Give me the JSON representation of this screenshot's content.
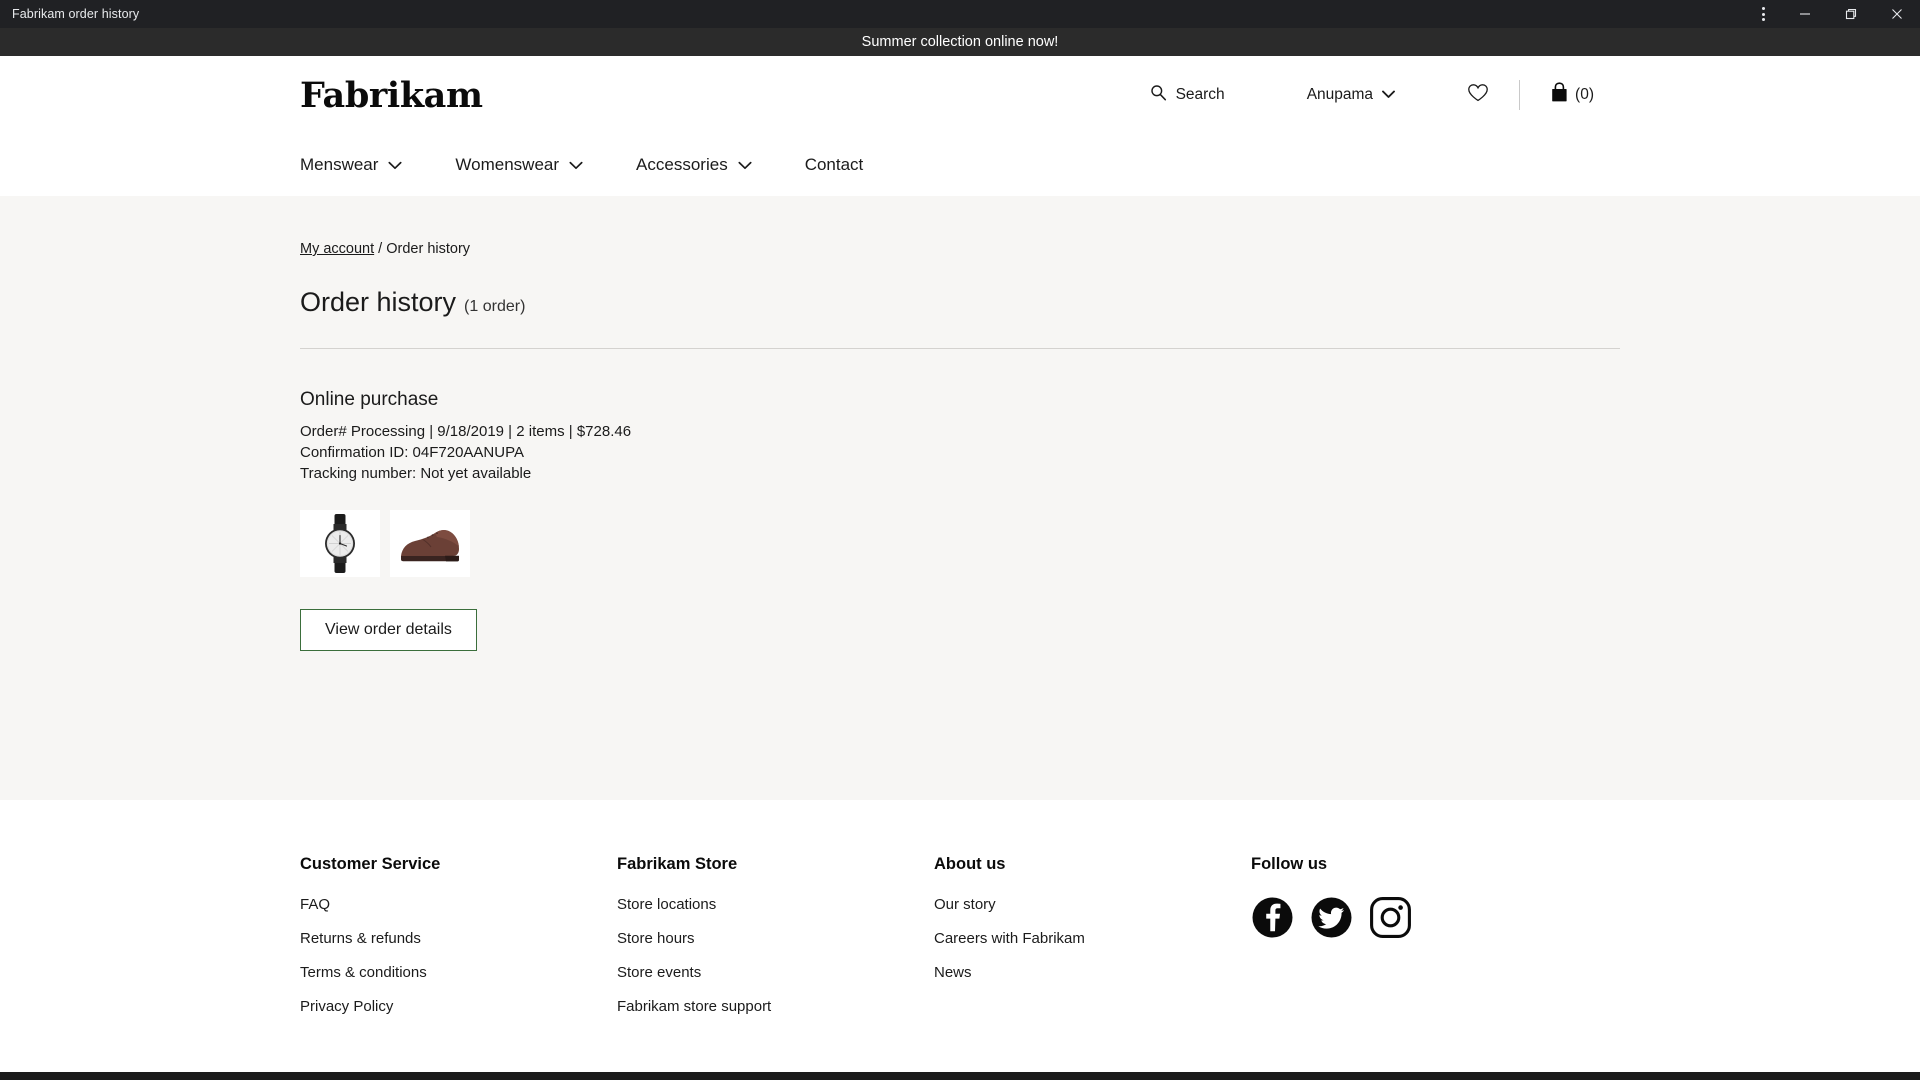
{
  "window": {
    "title": "Fabrikam order history",
    "controls": {
      "menu": "browser-menu",
      "minimize": "minimize",
      "restore": "restore",
      "close": "close"
    }
  },
  "promo": {
    "text": "Summer collection online now!"
  },
  "header": {
    "logo": "Fabrikam",
    "search_label": "Search",
    "account_label": "Anupama",
    "wishlist_icon": "heart-icon",
    "cart_count": "(0)"
  },
  "nav": {
    "items": [
      {
        "label": "Menswear",
        "has_chevron": true
      },
      {
        "label": "Womenswear",
        "has_chevron": true
      },
      {
        "label": "Accessories",
        "has_chevron": true
      },
      {
        "label": "Contact",
        "has_chevron": false
      }
    ]
  },
  "breadcrumb": {
    "link": "My account",
    "separator": "/",
    "current": "Order history"
  },
  "page": {
    "title": "Order history",
    "count": "(1 order)"
  },
  "order": {
    "heading": "Online purchase",
    "summary": "Order# Processing | 9/18/2019 | 2 items | $728.46",
    "confirmation": "Confirmation ID: 04F720AANUPA",
    "tracking": "Tracking number: Not yet available",
    "items": [
      {
        "name": "wristwatch-thumbnail",
        "alt": "Wristwatch with black strap"
      },
      {
        "name": "dress-shoe-thumbnail",
        "alt": "Brown leather dress shoe"
      }
    ],
    "details_button": "View order details"
  },
  "footer": {
    "columns": [
      {
        "title": "Customer Service",
        "links": [
          "FAQ",
          "Returns & refunds",
          "Terms & conditions",
          "Privacy Policy"
        ]
      },
      {
        "title": "Fabrikam Store",
        "links": [
          "Store locations",
          "Store hours",
          "Store events",
          "Fabrikam store support"
        ]
      },
      {
        "title": "About us",
        "links": [
          "Our story",
          "Careers with Fabrikam",
          "News"
        ]
      }
    ],
    "follow": {
      "title": "Follow us",
      "socials": [
        "facebook-icon",
        "twitter-icon",
        "instagram-icon"
      ]
    }
  },
  "colors": {
    "titlebar": "#202124",
    "promo_bg": "#2b2b2b",
    "content_bg": "#f7f6f4",
    "button_border": "#3b6e3b",
    "text": "#1b1b1b"
  }
}
